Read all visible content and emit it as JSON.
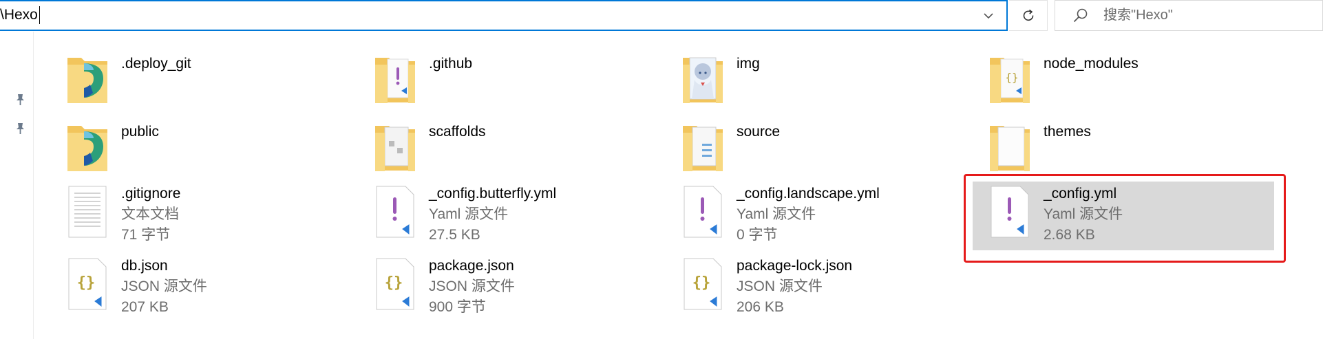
{
  "address_bar": {
    "path": "\\Hexo"
  },
  "search": {
    "placeholder": "搜索\"Hexo\""
  },
  "colors": {
    "accent": "#0078d7",
    "highlight_border": "#e51a1a",
    "selected_bg": "#d9d9d9",
    "folder": "#f6d27a"
  },
  "items": [
    {
      "name": ".deploy_git",
      "kind": "folder",
      "overlay": "folder-app-icon"
    },
    {
      "name": ".github",
      "kind": "folder",
      "overlay": "yaml-file-icon"
    },
    {
      "name": "img",
      "kind": "folder",
      "overlay": "anime-picture-icon"
    },
    {
      "name": "node_modules",
      "kind": "folder",
      "overlay": "json-file-icon"
    },
    {
      "name": "public",
      "kind": "folder",
      "overlay": "folder-app-icon"
    },
    {
      "name": "scaffolds",
      "kind": "folder",
      "overlay": "document-icon"
    },
    {
      "name": "source",
      "kind": "folder",
      "overlay": "document-icon"
    },
    {
      "name": "themes",
      "kind": "folder",
      "overlay": "blank-page-icon"
    },
    {
      "name": ".gitignore",
      "type": "文本文档",
      "size": "71 字节",
      "kind": "text"
    },
    {
      "name": "_config.butterfly.yml",
      "type": "Yaml 源文件",
      "size": "27.5 KB",
      "kind": "yaml"
    },
    {
      "name": "_config.landscape.yml",
      "type": "Yaml 源文件",
      "size": "0 字节",
      "kind": "yaml"
    },
    {
      "name": "_config.yml",
      "type": "Yaml 源文件",
      "size": "2.68 KB",
      "kind": "yaml",
      "selected": true
    },
    {
      "name": "db.json",
      "type": "JSON 源文件",
      "size": "207 KB",
      "kind": "json"
    },
    {
      "name": "package.json",
      "type": "JSON 源文件",
      "size": "900 字节",
      "kind": "json"
    },
    {
      "name": "package-lock.json",
      "type": "JSON 源文件",
      "size": "206 KB",
      "kind": "json"
    }
  ]
}
